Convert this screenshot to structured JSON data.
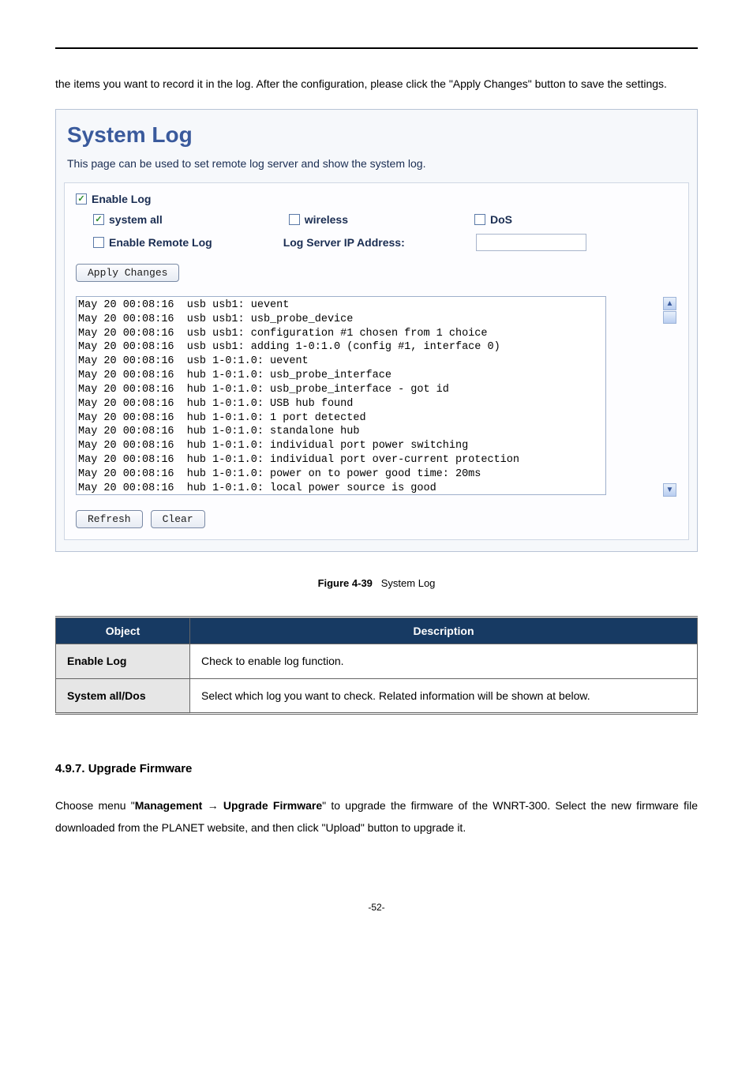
{
  "intro": "the items you want to record it in the log. After the configuration, please click the \"Apply Changes\" button to save the settings.",
  "panel": {
    "title": "System Log",
    "desc": "This page can be used to set remote log server and show the system log.",
    "checkboxes": {
      "enable_log": "Enable Log",
      "system_all": "system all",
      "wireless": "wireless",
      "dos": "DoS",
      "enable_remote": "Enable Remote Log"
    },
    "log_server_label": "Log Server IP Address:",
    "buttons": {
      "apply": "Apply Changes",
      "refresh": "Refresh",
      "clear": "Clear"
    },
    "log_text": "May 20 00:08:16  usb usb1: uevent\nMay 20 00:08:16  usb usb1: usb_probe_device\nMay 20 00:08:16  usb usb1: configuration #1 chosen from 1 choice\nMay 20 00:08:16  usb usb1: adding 1-0:1.0 (config #1, interface 0)\nMay 20 00:08:16  usb 1-0:1.0: uevent\nMay 20 00:08:16  hub 1-0:1.0: usb_probe_interface\nMay 20 00:08:16  hub 1-0:1.0: usb_probe_interface - got id\nMay 20 00:08:16  hub 1-0:1.0: USB hub found\nMay 20 00:08:16  hub 1-0:1.0: 1 port detected\nMay 20 00:08:16  hub 1-0:1.0: standalone hub\nMay 20 00:08:16  hub 1-0:1.0: individual port power switching\nMay 20 00:08:16  hub 1-0:1.0: individual port over-current protection\nMay 20 00:08:16  hub 1-0:1.0: power on to power good time: 20ms\nMay 20 00:08:16  hub 1-0:1.0: local power source is good"
  },
  "figure": {
    "label": "Figure 4-39",
    "caption": "System Log"
  },
  "table": {
    "head_object": "Object",
    "head_desc": "Description",
    "rows": [
      {
        "obj": "Enable Log",
        "desc": "Check to enable log function."
      },
      {
        "obj": "System all/Dos",
        "desc": "Select which log you want to check. Related information will be shown at below."
      }
    ]
  },
  "section": {
    "heading": "4.9.7.  Upgrade Firmware",
    "para_prefix": "Choose menu \"",
    "para_bold1": "Management",
    "para_arrow": " → ",
    "para_bold2": "Upgrade Firmware",
    "para_suffix": "\" to upgrade the firmware of the WNRT-300. Select the new firmware file downloaded from the PLANET website, and then click \"Upload\" button to upgrade it."
  },
  "page_number": "-52-"
}
